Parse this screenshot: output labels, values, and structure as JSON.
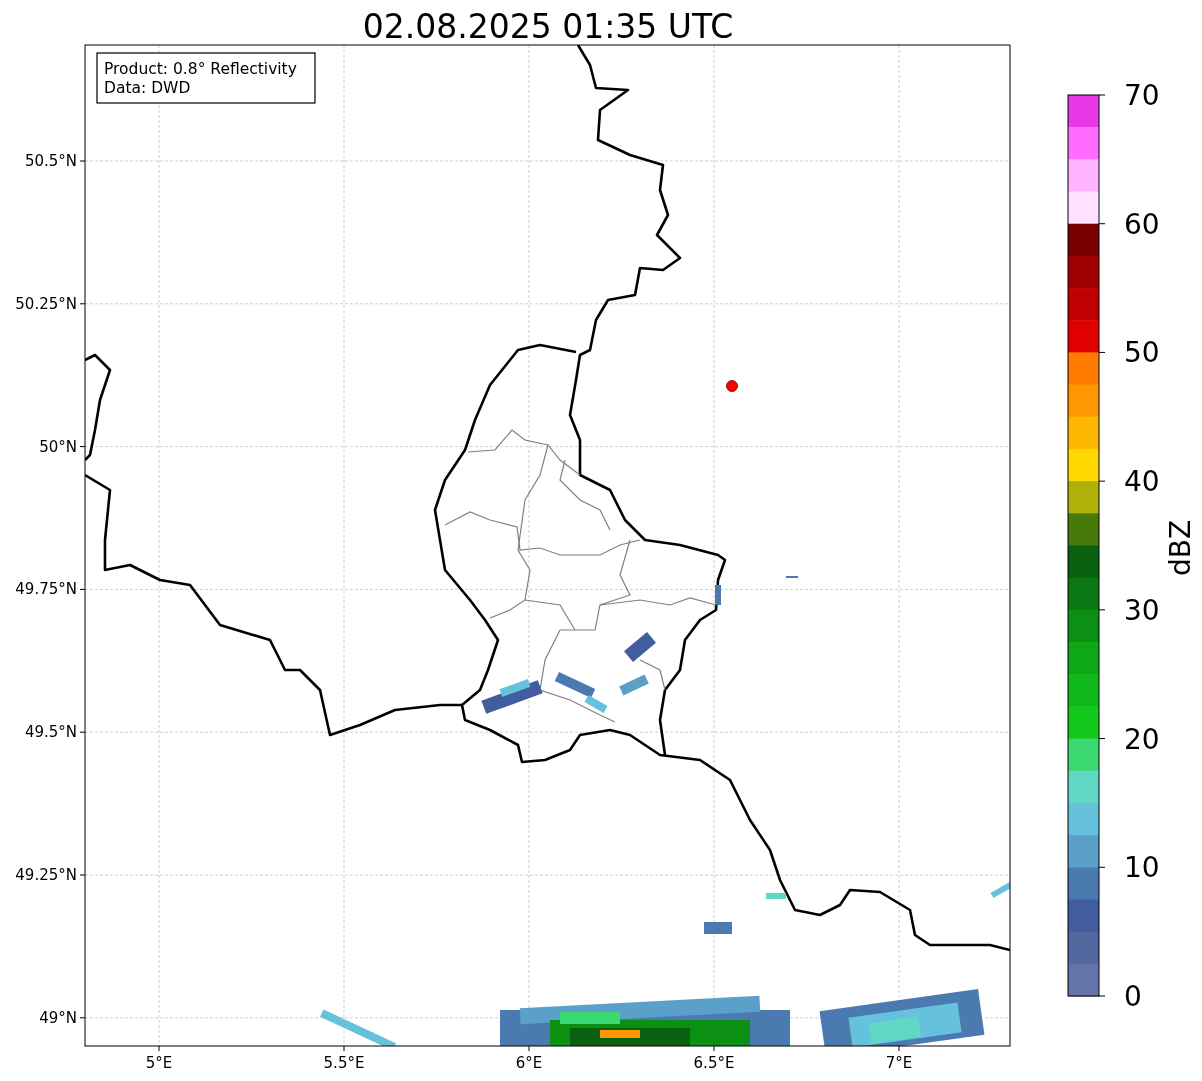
{
  "title": "02.08.2025 01:35 UTC",
  "info_box": [
    "Product: 0.8° Reflectivity",
    "Data: DWD"
  ],
  "map": {
    "xticks": [
      "5°E",
      "5.5°E",
      "6°E",
      "6.5°E",
      "7°E"
    ],
    "yticks": [
      "50.5°N",
      "50.25°N",
      "50°N",
      "49.75°N",
      "49.5°N",
      "49.25°N",
      "49°N"
    ]
  },
  "colorbar": {
    "label": "dBZ",
    "ticks": [
      "70",
      "60",
      "50",
      "40",
      "30",
      "20",
      "10",
      "0"
    ],
    "bands": [
      {
        "color": "#e838e8"
      },
      {
        "color": "#ff6cff"
      },
      {
        "color": "#ffb4ff"
      },
      {
        "color": "#ffe0ff"
      },
      {
        "color": "#780000"
      },
      {
        "color": "#a00000"
      },
      {
        "color": "#c00000"
      },
      {
        "color": "#e00000"
      },
      {
        "color": "#ff7c00"
      },
      {
        "color": "#ff9800"
      },
      {
        "color": "#ffb800"
      },
      {
        "color": "#ffd800"
      },
      {
        "color": "#b0b00a"
      },
      {
        "color": "#467a0a"
      },
      {
        "color": "#086010"
      },
      {
        "color": "#0a7812"
      },
      {
        "color": "#0c9014"
      },
      {
        "color": "#0ea816"
      },
      {
        "color": "#10b81a"
      },
      {
        "color": "#12c81a"
      },
      {
        "color": "#3cd870"
      },
      {
        "color": "#60d8c4"
      },
      {
        "color": "#66c2dc"
      },
      {
        "color": "#5aa0c8"
      },
      {
        "color": "#4a7ab0"
      },
      {
        "color": "#425d9e"
      },
      {
        "color": "#52689e"
      },
      {
        "color": "#6474a8"
      }
    ]
  }
}
